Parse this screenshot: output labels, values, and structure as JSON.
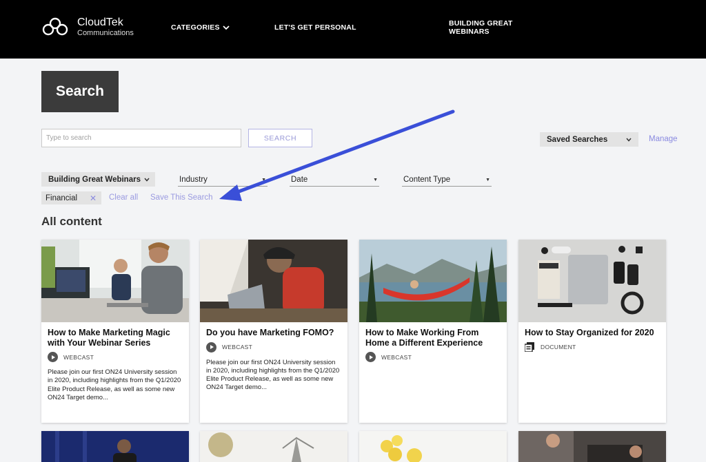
{
  "header": {
    "logo_name": "CloudTek",
    "logo_sub": "Communications",
    "nav": {
      "categories": "CATEGORIES",
      "personal": "LET'S GET PERSONAL",
      "webinars": "BUILDING GREAT WEBINARS"
    }
  },
  "search": {
    "title": "Search",
    "placeholder": "Type to search",
    "button": "SEARCH",
    "saved_searches": "Saved Searches",
    "manage": "Manage"
  },
  "filters": {
    "category": "Building Great Webinars",
    "industry": "Industry",
    "date": "Date",
    "content_type": "Content Type",
    "active_tag": "Financial",
    "clear_all": "Clear all",
    "save_search": "Save This Search"
  },
  "section_title": "All content",
  "cards": [
    {
      "title": "How to Make Marketing Magic with Your Webinar Series",
      "type": "WEBCAST",
      "icon": "play-icon",
      "description": "Please join our first ON24 University session in 2020, including highlights from the Q1/2020 Elite Product Release, as well as some new ON24 Target demo..."
    },
    {
      "title": "Do you have Marketing FOMO?",
      "type": "WEBCAST",
      "icon": "play-icon",
      "description": "Please join our first ON24 University session in 2020, including highlights from the Q1/2020 Elite Product Release, as well as some new ON24 Target demo..."
    },
    {
      "title": "How to Make Working From Home a Different Experience",
      "type": "WEBCAST",
      "icon": "play-icon",
      "description": ""
    },
    {
      "title": "How to Stay Organized for 2020",
      "type": "DOCUMENT",
      "icon": "pdf-icon",
      "description": ""
    }
  ],
  "colors": {
    "header_bg": "#000000",
    "accent_link": "#8a8ae0",
    "annotation_arrow": "#3a4fd8",
    "search_title_bg": "#3b3b3b"
  }
}
